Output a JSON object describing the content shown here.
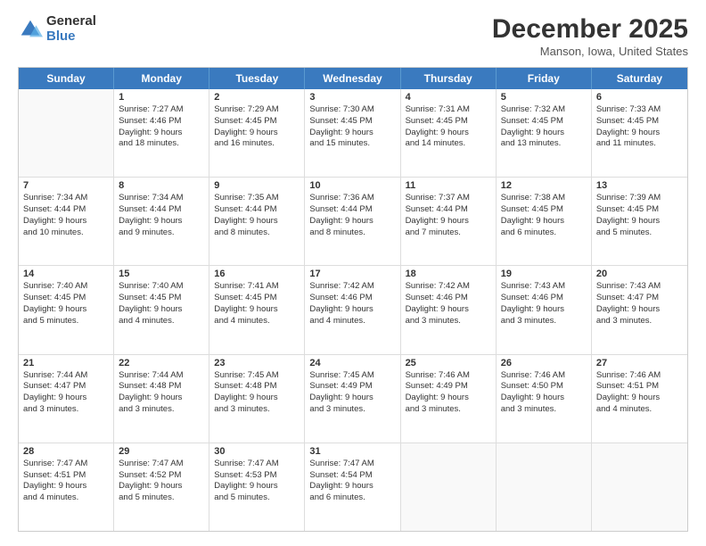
{
  "logo": {
    "general": "General",
    "blue": "Blue"
  },
  "header": {
    "month": "December 2025",
    "location": "Manson, Iowa, United States"
  },
  "weekdays": [
    "Sunday",
    "Monday",
    "Tuesday",
    "Wednesday",
    "Thursday",
    "Friday",
    "Saturday"
  ],
  "rows": [
    [
      {
        "day": "",
        "lines": []
      },
      {
        "day": "1",
        "lines": [
          "Sunrise: 7:27 AM",
          "Sunset: 4:46 PM",
          "Daylight: 9 hours",
          "and 18 minutes."
        ]
      },
      {
        "day": "2",
        "lines": [
          "Sunrise: 7:29 AM",
          "Sunset: 4:45 PM",
          "Daylight: 9 hours",
          "and 16 minutes."
        ]
      },
      {
        "day": "3",
        "lines": [
          "Sunrise: 7:30 AM",
          "Sunset: 4:45 PM",
          "Daylight: 9 hours",
          "and 15 minutes."
        ]
      },
      {
        "day": "4",
        "lines": [
          "Sunrise: 7:31 AM",
          "Sunset: 4:45 PM",
          "Daylight: 9 hours",
          "and 14 minutes."
        ]
      },
      {
        "day": "5",
        "lines": [
          "Sunrise: 7:32 AM",
          "Sunset: 4:45 PM",
          "Daylight: 9 hours",
          "and 13 minutes."
        ]
      },
      {
        "day": "6",
        "lines": [
          "Sunrise: 7:33 AM",
          "Sunset: 4:45 PM",
          "Daylight: 9 hours",
          "and 11 minutes."
        ]
      }
    ],
    [
      {
        "day": "7",
        "lines": [
          "Sunrise: 7:34 AM",
          "Sunset: 4:44 PM",
          "Daylight: 9 hours",
          "and 10 minutes."
        ]
      },
      {
        "day": "8",
        "lines": [
          "Sunrise: 7:34 AM",
          "Sunset: 4:44 PM",
          "Daylight: 9 hours",
          "and 9 minutes."
        ]
      },
      {
        "day": "9",
        "lines": [
          "Sunrise: 7:35 AM",
          "Sunset: 4:44 PM",
          "Daylight: 9 hours",
          "and 8 minutes."
        ]
      },
      {
        "day": "10",
        "lines": [
          "Sunrise: 7:36 AM",
          "Sunset: 4:44 PM",
          "Daylight: 9 hours",
          "and 8 minutes."
        ]
      },
      {
        "day": "11",
        "lines": [
          "Sunrise: 7:37 AM",
          "Sunset: 4:44 PM",
          "Daylight: 9 hours",
          "and 7 minutes."
        ]
      },
      {
        "day": "12",
        "lines": [
          "Sunrise: 7:38 AM",
          "Sunset: 4:45 PM",
          "Daylight: 9 hours",
          "and 6 minutes."
        ]
      },
      {
        "day": "13",
        "lines": [
          "Sunrise: 7:39 AM",
          "Sunset: 4:45 PM",
          "Daylight: 9 hours",
          "and 5 minutes."
        ]
      }
    ],
    [
      {
        "day": "14",
        "lines": [
          "Sunrise: 7:40 AM",
          "Sunset: 4:45 PM",
          "Daylight: 9 hours",
          "and 5 minutes."
        ]
      },
      {
        "day": "15",
        "lines": [
          "Sunrise: 7:40 AM",
          "Sunset: 4:45 PM",
          "Daylight: 9 hours",
          "and 4 minutes."
        ]
      },
      {
        "day": "16",
        "lines": [
          "Sunrise: 7:41 AM",
          "Sunset: 4:45 PM",
          "Daylight: 9 hours",
          "and 4 minutes."
        ]
      },
      {
        "day": "17",
        "lines": [
          "Sunrise: 7:42 AM",
          "Sunset: 4:46 PM",
          "Daylight: 9 hours",
          "and 4 minutes."
        ]
      },
      {
        "day": "18",
        "lines": [
          "Sunrise: 7:42 AM",
          "Sunset: 4:46 PM",
          "Daylight: 9 hours",
          "and 3 minutes."
        ]
      },
      {
        "day": "19",
        "lines": [
          "Sunrise: 7:43 AM",
          "Sunset: 4:46 PM",
          "Daylight: 9 hours",
          "and 3 minutes."
        ]
      },
      {
        "day": "20",
        "lines": [
          "Sunrise: 7:43 AM",
          "Sunset: 4:47 PM",
          "Daylight: 9 hours",
          "and 3 minutes."
        ]
      }
    ],
    [
      {
        "day": "21",
        "lines": [
          "Sunrise: 7:44 AM",
          "Sunset: 4:47 PM",
          "Daylight: 9 hours",
          "and 3 minutes."
        ]
      },
      {
        "day": "22",
        "lines": [
          "Sunrise: 7:44 AM",
          "Sunset: 4:48 PM",
          "Daylight: 9 hours",
          "and 3 minutes."
        ]
      },
      {
        "day": "23",
        "lines": [
          "Sunrise: 7:45 AM",
          "Sunset: 4:48 PM",
          "Daylight: 9 hours",
          "and 3 minutes."
        ]
      },
      {
        "day": "24",
        "lines": [
          "Sunrise: 7:45 AM",
          "Sunset: 4:49 PM",
          "Daylight: 9 hours",
          "and 3 minutes."
        ]
      },
      {
        "day": "25",
        "lines": [
          "Sunrise: 7:46 AM",
          "Sunset: 4:49 PM",
          "Daylight: 9 hours",
          "and 3 minutes."
        ]
      },
      {
        "day": "26",
        "lines": [
          "Sunrise: 7:46 AM",
          "Sunset: 4:50 PM",
          "Daylight: 9 hours",
          "and 3 minutes."
        ]
      },
      {
        "day": "27",
        "lines": [
          "Sunrise: 7:46 AM",
          "Sunset: 4:51 PM",
          "Daylight: 9 hours",
          "and 4 minutes."
        ]
      }
    ],
    [
      {
        "day": "28",
        "lines": [
          "Sunrise: 7:47 AM",
          "Sunset: 4:51 PM",
          "Daylight: 9 hours",
          "and 4 minutes."
        ]
      },
      {
        "day": "29",
        "lines": [
          "Sunrise: 7:47 AM",
          "Sunset: 4:52 PM",
          "Daylight: 9 hours",
          "and 5 minutes."
        ]
      },
      {
        "day": "30",
        "lines": [
          "Sunrise: 7:47 AM",
          "Sunset: 4:53 PM",
          "Daylight: 9 hours",
          "and 5 minutes."
        ]
      },
      {
        "day": "31",
        "lines": [
          "Sunrise: 7:47 AM",
          "Sunset: 4:54 PM",
          "Daylight: 9 hours",
          "and 6 minutes."
        ]
      },
      {
        "day": "",
        "lines": []
      },
      {
        "day": "",
        "lines": []
      },
      {
        "day": "",
        "lines": []
      }
    ]
  ]
}
